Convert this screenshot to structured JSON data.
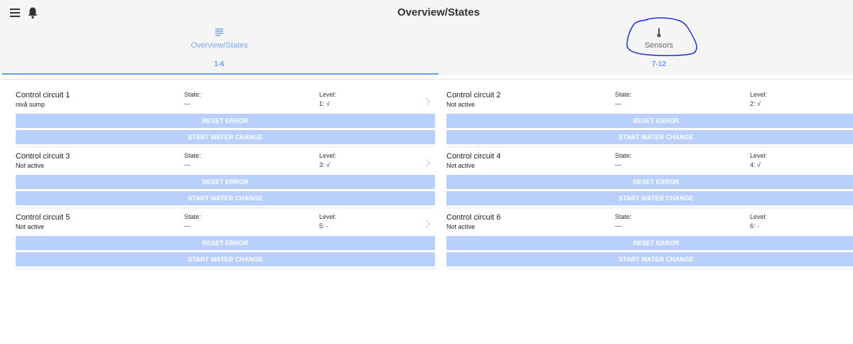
{
  "header": {
    "title": "Overview/States"
  },
  "tabs": [
    {
      "label": "Overview/States",
      "sub": "1-6"
    },
    {
      "label": "Sensors",
      "sub": "7-12"
    }
  ],
  "labels": {
    "state": "State:",
    "level": "Level:"
  },
  "buttons": {
    "reset": "RESET ERROR",
    "water_change": "START WATER CHANGE"
  },
  "circuits": [
    {
      "name": "Control circuit 1",
      "status": "nivå sump",
      "state": "---",
      "level": "1: √"
    },
    {
      "name": "Control circuit 2",
      "status": "Not active",
      "state": "---",
      "level": "2: √"
    },
    {
      "name": "Control circuit 3",
      "status": "Not active",
      "state": "---",
      "level": "3: √"
    },
    {
      "name": "Control circuit 4",
      "status": "Not active",
      "state": "---",
      "level": "4: √"
    },
    {
      "name": "Control circuit 5",
      "status": "Not active",
      "state": "---",
      "level": "5: -"
    },
    {
      "name": "Control circuit 6",
      "status": "Not active",
      "state": "---",
      "level": "6: -"
    }
  ],
  "colors": {
    "accent": "#6c9ee9",
    "button_bg": "#b8d0fb",
    "annotation": "#1a2fd6"
  }
}
